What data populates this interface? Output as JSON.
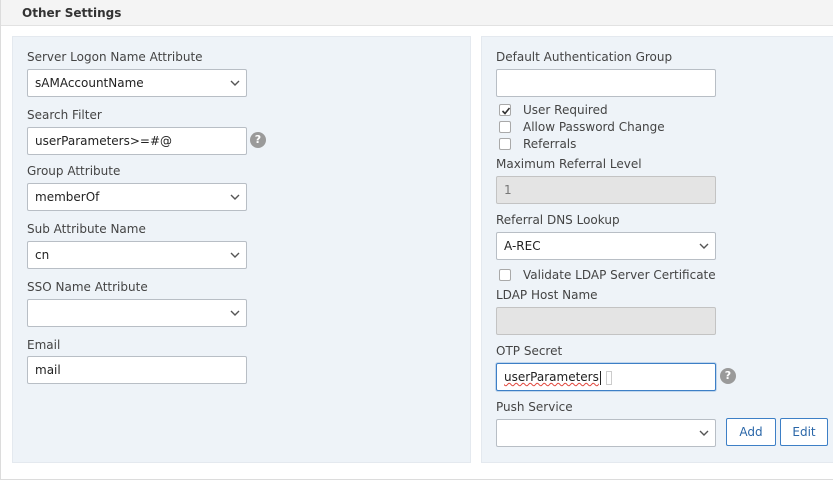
{
  "section": {
    "title": "Other Settings"
  },
  "left": {
    "server_logon": {
      "label": "Server Logon Name Attribute",
      "value": "sAMAccountName"
    },
    "search_filter": {
      "label": "Search Filter",
      "value": "userParameters>=#@"
    },
    "group_attribute": {
      "label": "Group Attribute",
      "value": "memberOf"
    },
    "sub_attribute": {
      "label": "Sub Attribute Name",
      "value": "cn"
    },
    "sso_name": {
      "label": "SSO Name Attribute",
      "value": ""
    },
    "email": {
      "label": "Email",
      "value": "mail"
    }
  },
  "right": {
    "default_auth_group": {
      "label": "Default Authentication Group",
      "value": ""
    },
    "user_required": {
      "label": "User Required",
      "checked": true
    },
    "allow_password_change": {
      "label": "Allow Password Change",
      "checked": false
    },
    "referrals": {
      "label": "Referrals",
      "checked": false
    },
    "max_referral_level": {
      "label": "Maximum Referral Level",
      "value": "1"
    },
    "referral_dns": {
      "label": "Referral DNS Lookup",
      "value": "A-REC"
    },
    "validate_ldap": {
      "label": "Validate LDAP Server Certificate",
      "checked": false
    },
    "ldap_host": {
      "label": "LDAP Host Name",
      "value": ""
    },
    "otp_secret": {
      "label": "OTP Secret",
      "value": "userParameters"
    },
    "push_service": {
      "label": "Push Service",
      "value": "",
      "add_label": "Add",
      "edit_label": "Edit"
    }
  },
  "help_glyph": "?",
  "colors": {
    "panel_bg": "#eef3f8",
    "accent": "#3d7fc6",
    "help_bg": "#9a9a9a"
  },
  "icons": {
    "dropdown": "chevron-down-icon",
    "help": "help-icon",
    "check": "checkmark-icon"
  }
}
